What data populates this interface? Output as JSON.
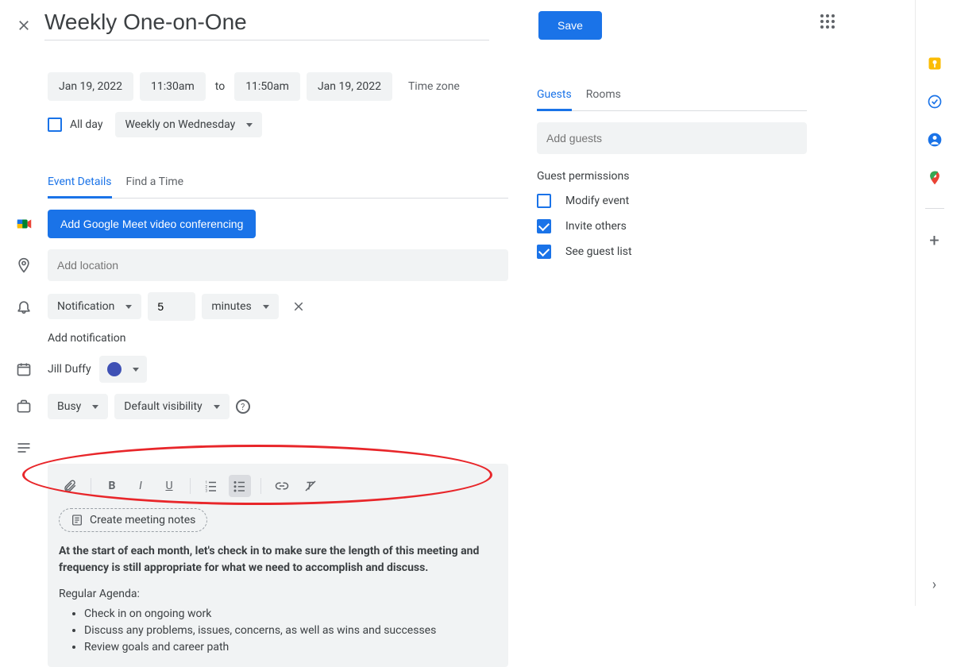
{
  "header": {
    "title": "Weekly One-on-One",
    "save_label": "Save"
  },
  "datetime": {
    "start_date": "Jan 19, 2022",
    "start_time": "11:30am",
    "to_label": "to",
    "end_time": "11:50am",
    "end_date": "Jan 19, 2022",
    "timezone_label": "Time zone"
  },
  "allday": {
    "label": "All day",
    "checked": false,
    "recurrence": "Weekly on Wednesday"
  },
  "tabs": {
    "event_details": "Event Details",
    "find_time": "Find a Time"
  },
  "meet": {
    "button_label": "Add Google Meet video conferencing"
  },
  "location": {
    "placeholder": "Add location"
  },
  "notification": {
    "type": "Notification",
    "value": "5",
    "unit": "minutes",
    "add_label": "Add notification"
  },
  "calendar": {
    "owner": "Jill Duffy"
  },
  "availability": {
    "busy": "Busy",
    "visibility": "Default visibility"
  },
  "description": {
    "create_notes": "Create meeting notes",
    "bold_text": "At the start of each month, let's check in to make sure the length of this meeting and frequency is still appropriate for what we need to accomplish and discuss.",
    "agenda_header": "Regular Agenda:",
    "agenda_items": [
      "Check in on ongoing work",
      "Discuss any problems, issues, concerns, as well as wins and successes",
      "Review goals and career path"
    ]
  },
  "guests": {
    "tab_guests": "Guests",
    "tab_rooms": "Rooms",
    "placeholder": "Add guests",
    "permissions_title": "Guest permissions",
    "modify_event": "Modify event",
    "invite_others": "Invite others",
    "see_guest_list": "See guest list"
  }
}
